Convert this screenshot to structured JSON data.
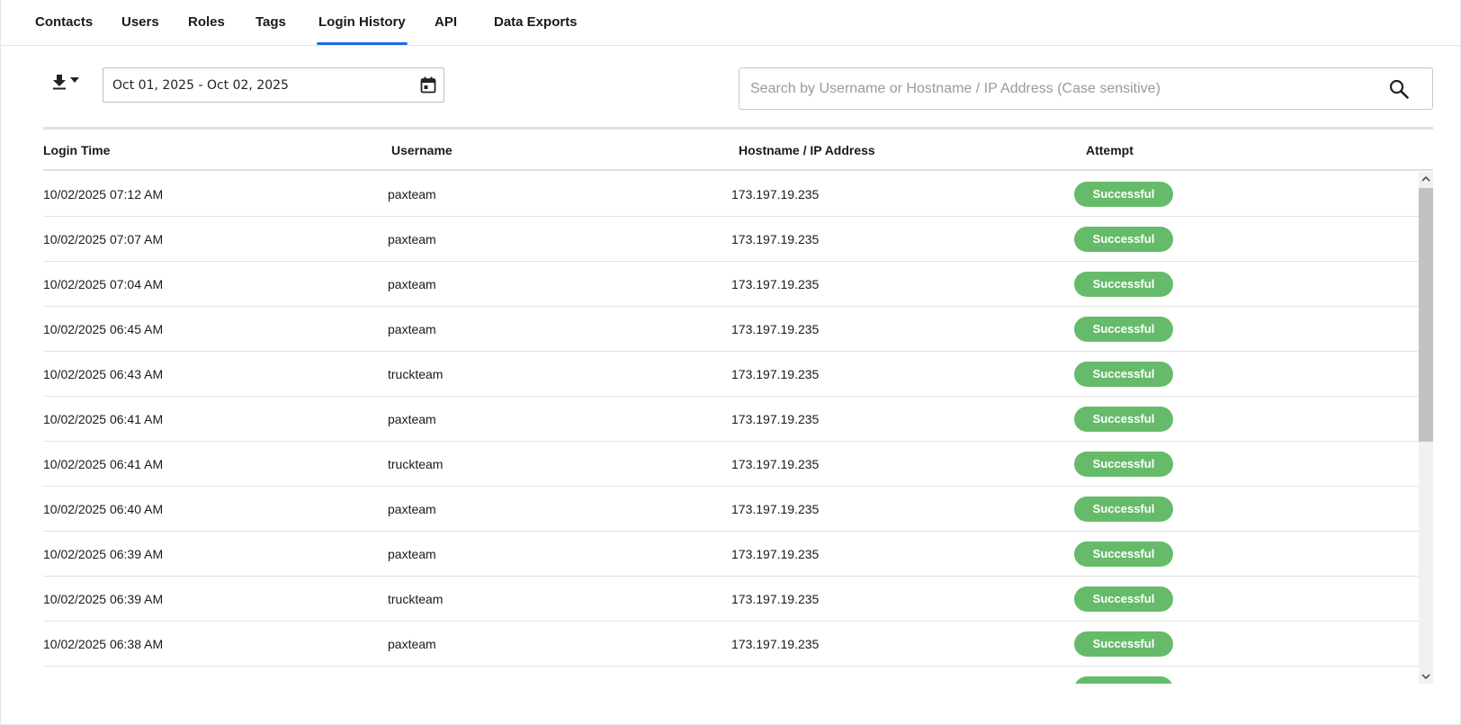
{
  "tabs": [
    {
      "label": "Contacts"
    },
    {
      "label": "Users"
    },
    {
      "label": "Roles"
    },
    {
      "label": "Tags"
    },
    {
      "label": "Login History",
      "active": true
    },
    {
      "label": "API"
    },
    {
      "label": "Data Exports"
    }
  ],
  "toolbar": {
    "date_range": "Oct 01, 2025 - Oct 02, 2025",
    "search_placeholder": "Search by Username or Hostname / IP Address (Case sensitive)",
    "search_value": ""
  },
  "table": {
    "columns": [
      "Login Time",
      "Username",
      "Hostname / IP Address",
      "Attempt"
    ],
    "rows": [
      {
        "time": "10/02/2025 07:12 AM",
        "user": "paxteam",
        "host": "173.197.19.235",
        "attempt": "Successful"
      },
      {
        "time": "10/02/2025 07:07 AM",
        "user": "paxteam",
        "host": "173.197.19.235",
        "attempt": "Successful"
      },
      {
        "time": "10/02/2025 07:04 AM",
        "user": "paxteam",
        "host": "173.197.19.235",
        "attempt": "Successful"
      },
      {
        "time": "10/02/2025 06:45 AM",
        "user": "paxteam",
        "host": "173.197.19.235",
        "attempt": "Successful"
      },
      {
        "time": "10/02/2025 06:43 AM",
        "user": "truckteam",
        "host": "173.197.19.235",
        "attempt": "Successful"
      },
      {
        "time": "10/02/2025 06:41 AM",
        "user": "paxteam",
        "host": "173.197.19.235",
        "attempt": "Successful"
      },
      {
        "time": "10/02/2025 06:41 AM",
        "user": "truckteam",
        "host": "173.197.19.235",
        "attempt": "Successful"
      },
      {
        "time": "10/02/2025 06:40 AM",
        "user": "paxteam",
        "host": "173.197.19.235",
        "attempt": "Successful"
      },
      {
        "time": "10/02/2025 06:39 AM",
        "user": "paxteam",
        "host": "173.197.19.235",
        "attempt": "Successful"
      },
      {
        "time": "10/02/2025 06:39 AM",
        "user": "truckteam",
        "host": "173.197.19.235",
        "attempt": "Successful"
      },
      {
        "time": "10/02/2025 06:38 AM",
        "user": "paxteam",
        "host": "173.197.19.235",
        "attempt": "Successful"
      },
      {
        "time": "",
        "user": "",
        "host": "",
        "attempt": "Successful"
      }
    ]
  },
  "colors": {
    "accent": "#1f6fd8",
    "success": "#66bb6a"
  },
  "icons": {
    "export": "download-icon",
    "dropdown": "caret-down-icon",
    "calendar": "calendar-icon",
    "search": "search-icon"
  }
}
